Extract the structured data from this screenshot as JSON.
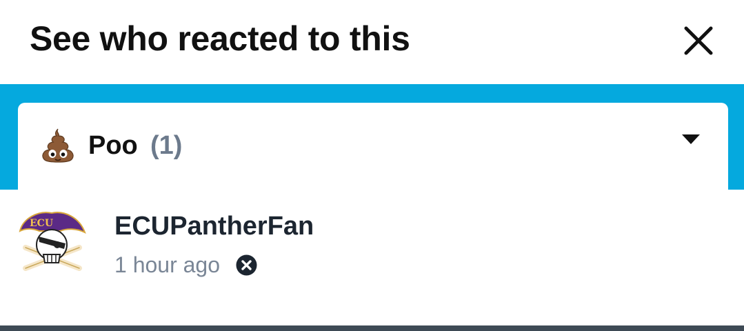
{
  "modal": {
    "title": "See who reacted to this",
    "close_icon": "close-icon"
  },
  "reaction_filter": {
    "emoji_icon": "pile-of-poo-icon",
    "name": "Poo",
    "count": "(1)",
    "dropdown_icon": "caret-down-icon"
  },
  "reactors": [
    {
      "avatar": "ecu-pirate-logo",
      "username": "ECUPantherFan",
      "time": "1 hour ago",
      "remove_icon": "remove-reaction-icon"
    }
  ],
  "colors": {
    "accent": "#05a9de",
    "count_text": "#6c7a8c",
    "meta_text": "#7a8696",
    "footer": "#3e4a55"
  }
}
